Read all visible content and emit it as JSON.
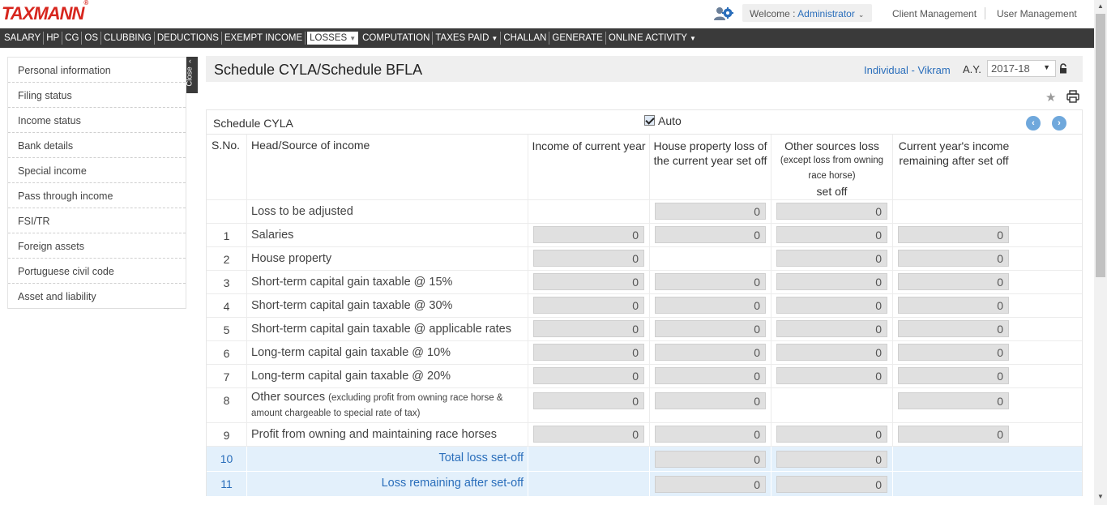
{
  "brand": {
    "logo_text": "TAXMANN",
    "logo_mark": "®"
  },
  "header": {
    "welcome_label": "Welcome : ",
    "user_name": "Administrator",
    "client_management": "Client Management",
    "user_management": "User Management"
  },
  "menu": [
    {
      "label": "SALARY",
      "dropdown": false,
      "active": false
    },
    {
      "label": "HP",
      "dropdown": false,
      "active": false
    },
    {
      "label": "CG",
      "dropdown": false,
      "active": false
    },
    {
      "label": "OS",
      "dropdown": false,
      "active": false
    },
    {
      "label": "CLUBBING",
      "dropdown": false,
      "active": false
    },
    {
      "label": "DEDUCTIONS",
      "dropdown": false,
      "active": false
    },
    {
      "label": "EXEMPT INCOME",
      "dropdown": false,
      "active": false
    },
    {
      "label": "LOSSES",
      "dropdown": true,
      "active": true
    },
    {
      "label": "COMPUTATION",
      "dropdown": false,
      "active": false
    },
    {
      "label": "TAXES PAID",
      "dropdown": true,
      "active": false
    },
    {
      "label": "CHALLAN",
      "dropdown": false,
      "active": false
    },
    {
      "label": "GENERATE",
      "dropdown": false,
      "active": false
    },
    {
      "label": "ONLINE ACTIVITY",
      "dropdown": true,
      "active": false
    }
  ],
  "sidebar": {
    "close_label": "Close",
    "items": [
      "Personal information",
      "Filing status",
      "Income status",
      "Bank details",
      "Special income",
      "Pass through income",
      "FSI/TR",
      "Foreign assets",
      "Portuguese civil code",
      "Asset and liability"
    ]
  },
  "page": {
    "title": "Schedule CYLA/Schedule BFLA",
    "assessee": "Individual - Vikram",
    "ay_label": "A.Y.",
    "ay_value": "2017-18"
  },
  "schedule": {
    "title": "Schedule CYLA",
    "auto_label": "Auto",
    "auto_checked": true,
    "columns": {
      "sno": "S.No.",
      "head": "Head/Source of income",
      "income": "Income of current year",
      "hp_loss": "House property loss of the current year set off",
      "os_loss_main": "Other sources loss",
      "os_loss_note": "(except loss from owning race horse)",
      "os_loss_tail": "set off",
      "remaining": "Current year's income remaining after set off"
    },
    "rows": [
      {
        "sno": "",
        "head": "Loss to be adjusted",
        "sub": "",
        "income": null,
        "hp": "0",
        "os": "0",
        "rem": null,
        "kind": "norm"
      },
      {
        "sno": "1",
        "head": "Salaries",
        "sub": "",
        "income": "0",
        "hp": "0",
        "os": "0",
        "rem": "0",
        "kind": "norm"
      },
      {
        "sno": "2",
        "head": "House property",
        "sub": "",
        "income": "0",
        "hp": null,
        "os": "0",
        "rem": "0",
        "kind": "norm"
      },
      {
        "sno": "3",
        "head": "Short-term capital gain taxable @ 15%",
        "sub": "",
        "income": "0",
        "hp": "0",
        "os": "0",
        "rem": "0",
        "kind": "norm"
      },
      {
        "sno": "4",
        "head": "Short-term capital gain taxable @ 30%",
        "sub": "",
        "income": "0",
        "hp": "0",
        "os": "0",
        "rem": "0",
        "kind": "norm"
      },
      {
        "sno": "5",
        "head": "Short-term capital gain taxable @ applicable rates",
        "sub": "",
        "income": "0",
        "hp": "0",
        "os": "0",
        "rem": "0",
        "kind": "norm"
      },
      {
        "sno": "6",
        "head": "Long-term capital gain taxable @ 10%",
        "sub": "",
        "income": "0",
        "hp": "0",
        "os": "0",
        "rem": "0",
        "kind": "norm"
      },
      {
        "sno": "7",
        "head": "Long-term capital gain taxable @ 20%",
        "sub": "",
        "income": "0",
        "hp": "0",
        "os": "0",
        "rem": "0",
        "kind": "norm"
      },
      {
        "sno": "8",
        "head": "Other sources",
        "sub": "(excluding profit from owning race horse & amount chargeable to special rate of tax)",
        "income": "0",
        "hp": "0",
        "os": null,
        "rem": "0",
        "kind": "tall"
      },
      {
        "sno": "9",
        "head": "Profit from owning and maintaining race horses",
        "sub": "",
        "income": "0",
        "hp": "0",
        "os": "0",
        "rem": "0",
        "kind": "norm"
      },
      {
        "sno": "10",
        "head": "Total loss set-off",
        "sub": "",
        "income": null,
        "hp": "0",
        "os": "0",
        "rem": null,
        "kind": "tot"
      },
      {
        "sno": "11",
        "head": "Loss remaining after set-off",
        "sub": "",
        "income": null,
        "hp": "0",
        "os": "0",
        "rem": null,
        "kind": "tot"
      }
    ]
  },
  "icons": {
    "users": "users-gear-icon",
    "lock": "lock-icon",
    "star": "star-icon",
    "print": "print-icon",
    "prev": "chevron-left-icon",
    "next": "chevron-right-icon"
  },
  "colors": {
    "accent": "#2a6ebb",
    "brand": "#d7261e",
    "menubar": "#3a3a3a",
    "total_row": "#e3f0fb"
  }
}
